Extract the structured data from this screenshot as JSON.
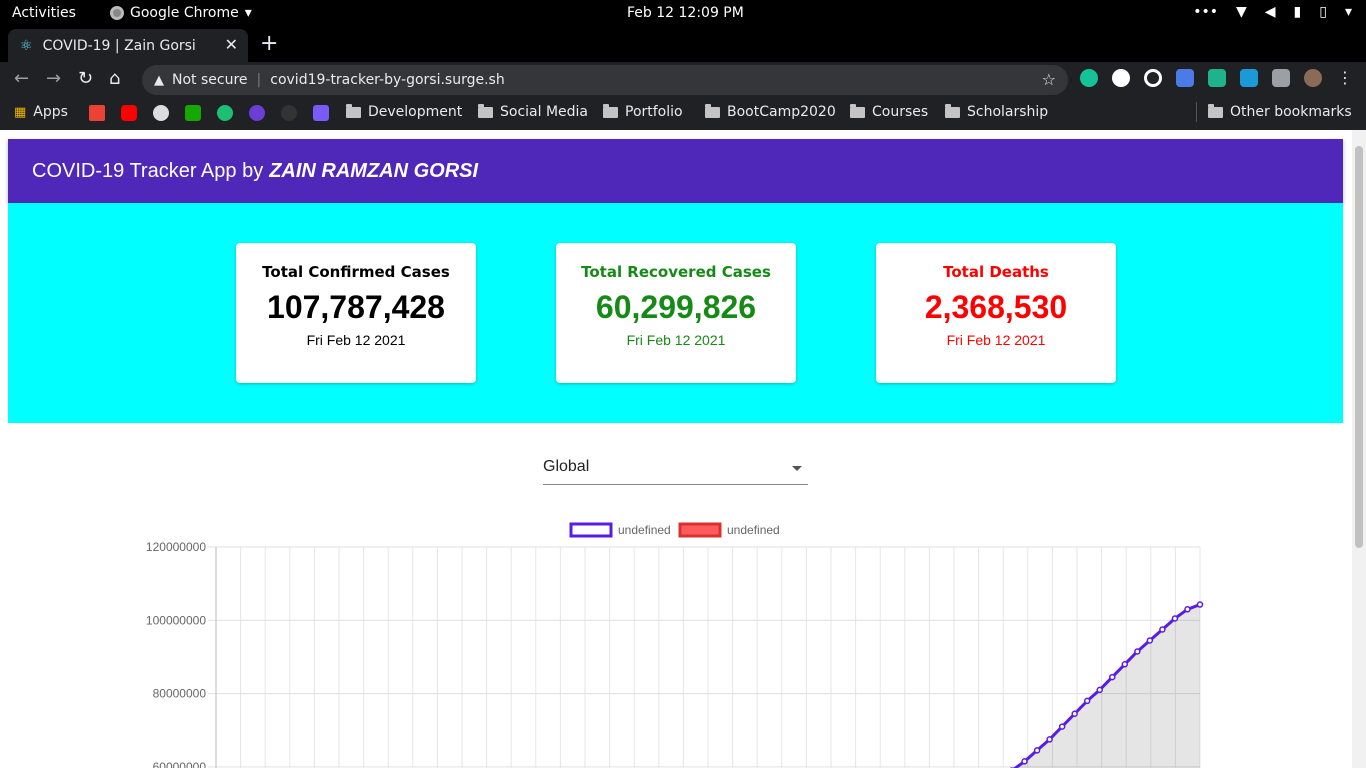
{
  "os_bar": {
    "activities": "Activities",
    "app_name": "Google Chrome",
    "clock": "Feb 12  12:09 PM",
    "tray_icons": [
      "more-icon",
      "wifi-icon",
      "volume-icon",
      "mic-icon",
      "battery-icon",
      "power-icon"
    ]
  },
  "browser": {
    "tab_title": "COVID-19 | Zain Gorsi",
    "security_label": "Not secure",
    "url": "covid19-tracker-by-gorsi.surge.sh",
    "bookmarks": {
      "apps_label": "Apps",
      "folders": [
        "Development",
        "Social Media",
        "Portfolio",
        "BootCamp2020",
        "Courses",
        "Scholarship"
      ],
      "other": "Other bookmarks"
    }
  },
  "app": {
    "title_prefix": "COVID-19 Tracker App by",
    "title_author": "ZAIN RAMZAN GORSI",
    "colors": {
      "appbar": "#4f27b9",
      "banner": "#00ffff",
      "confirmed": "#000000",
      "recovered": "#168a16",
      "deaths": "#ff0000"
    },
    "cards": [
      {
        "title": "Total Confirmed Cases",
        "value": "107,787,428",
        "date": "Fri Feb 12 2021"
      },
      {
        "title": "Total Recovered Cases",
        "value": "60,299,826",
        "date": "Fri Feb 12 2021"
      },
      {
        "title": "Total Deaths",
        "value": "2,368,530",
        "date": "Fri Feb 12 2021"
      }
    ],
    "country_select": {
      "value": "Global"
    }
  },
  "chart_data": {
    "type": "line",
    "legend": [
      {
        "name": "undefined",
        "color": "#5a1be6"
      },
      {
        "name": "undefined",
        "color": "#ff5b5b"
      }
    ],
    "legend_position": "top",
    "y_ticks": [
      "120000000",
      "100000000",
      "80000000",
      "60000000"
    ],
    "ylim": [
      60000000,
      120000000
    ],
    "grid": true,
    "x_points": 40,
    "series": [
      {
        "name": "undefined",
        "values": [
          59000000,
          61500000,
          64500000,
          67500000,
          71000000,
          74500000,
          78000000,
          81000000,
          84500000,
          88000000,
          91500000,
          94500000,
          97500000,
          100500000,
          103000000,
          104300000
        ]
      }
    ]
  }
}
